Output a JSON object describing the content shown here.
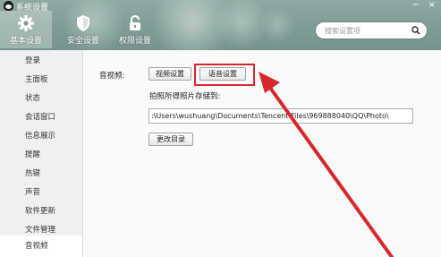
{
  "window": {
    "title": "系统设置",
    "controls": {
      "minimize": "−",
      "close": "×"
    }
  },
  "categories": [
    {
      "label": "基本设置",
      "icon": "gear-icon",
      "active": true
    },
    {
      "label": "安全设置",
      "icon": "shield-icon",
      "active": false
    },
    {
      "label": "权限设置",
      "icon": "lock-icon",
      "active": false
    }
  ],
  "search": {
    "placeholder": "搜索设置项",
    "icon": "search-icon"
  },
  "sidebar": {
    "items": [
      {
        "label": "登录"
      },
      {
        "label": "主面板"
      },
      {
        "label": "状态"
      },
      {
        "label": "会话窗口"
      },
      {
        "label": "信息展示"
      },
      {
        "label": "提醒"
      },
      {
        "label": "热键"
      },
      {
        "label": "声音"
      },
      {
        "label": "软件更新"
      },
      {
        "label": "文件管理"
      },
      {
        "label": "音视频",
        "active": true
      }
    ]
  },
  "main": {
    "section_label": "音视频:",
    "video_button": "视频设置",
    "voice_button": "语音设置",
    "save_path_label": "拍照所得照片存储到:",
    "save_path_value": ":\\Users\\wushuang\\Documents\\Tencent Files\\969888040\\QQ\\Photo\\",
    "change_dir_button": "更改目录"
  },
  "colors": {
    "header": "#7f9c95",
    "highlight": "#d8282c",
    "sidebar_bg": "#eef0f2"
  }
}
